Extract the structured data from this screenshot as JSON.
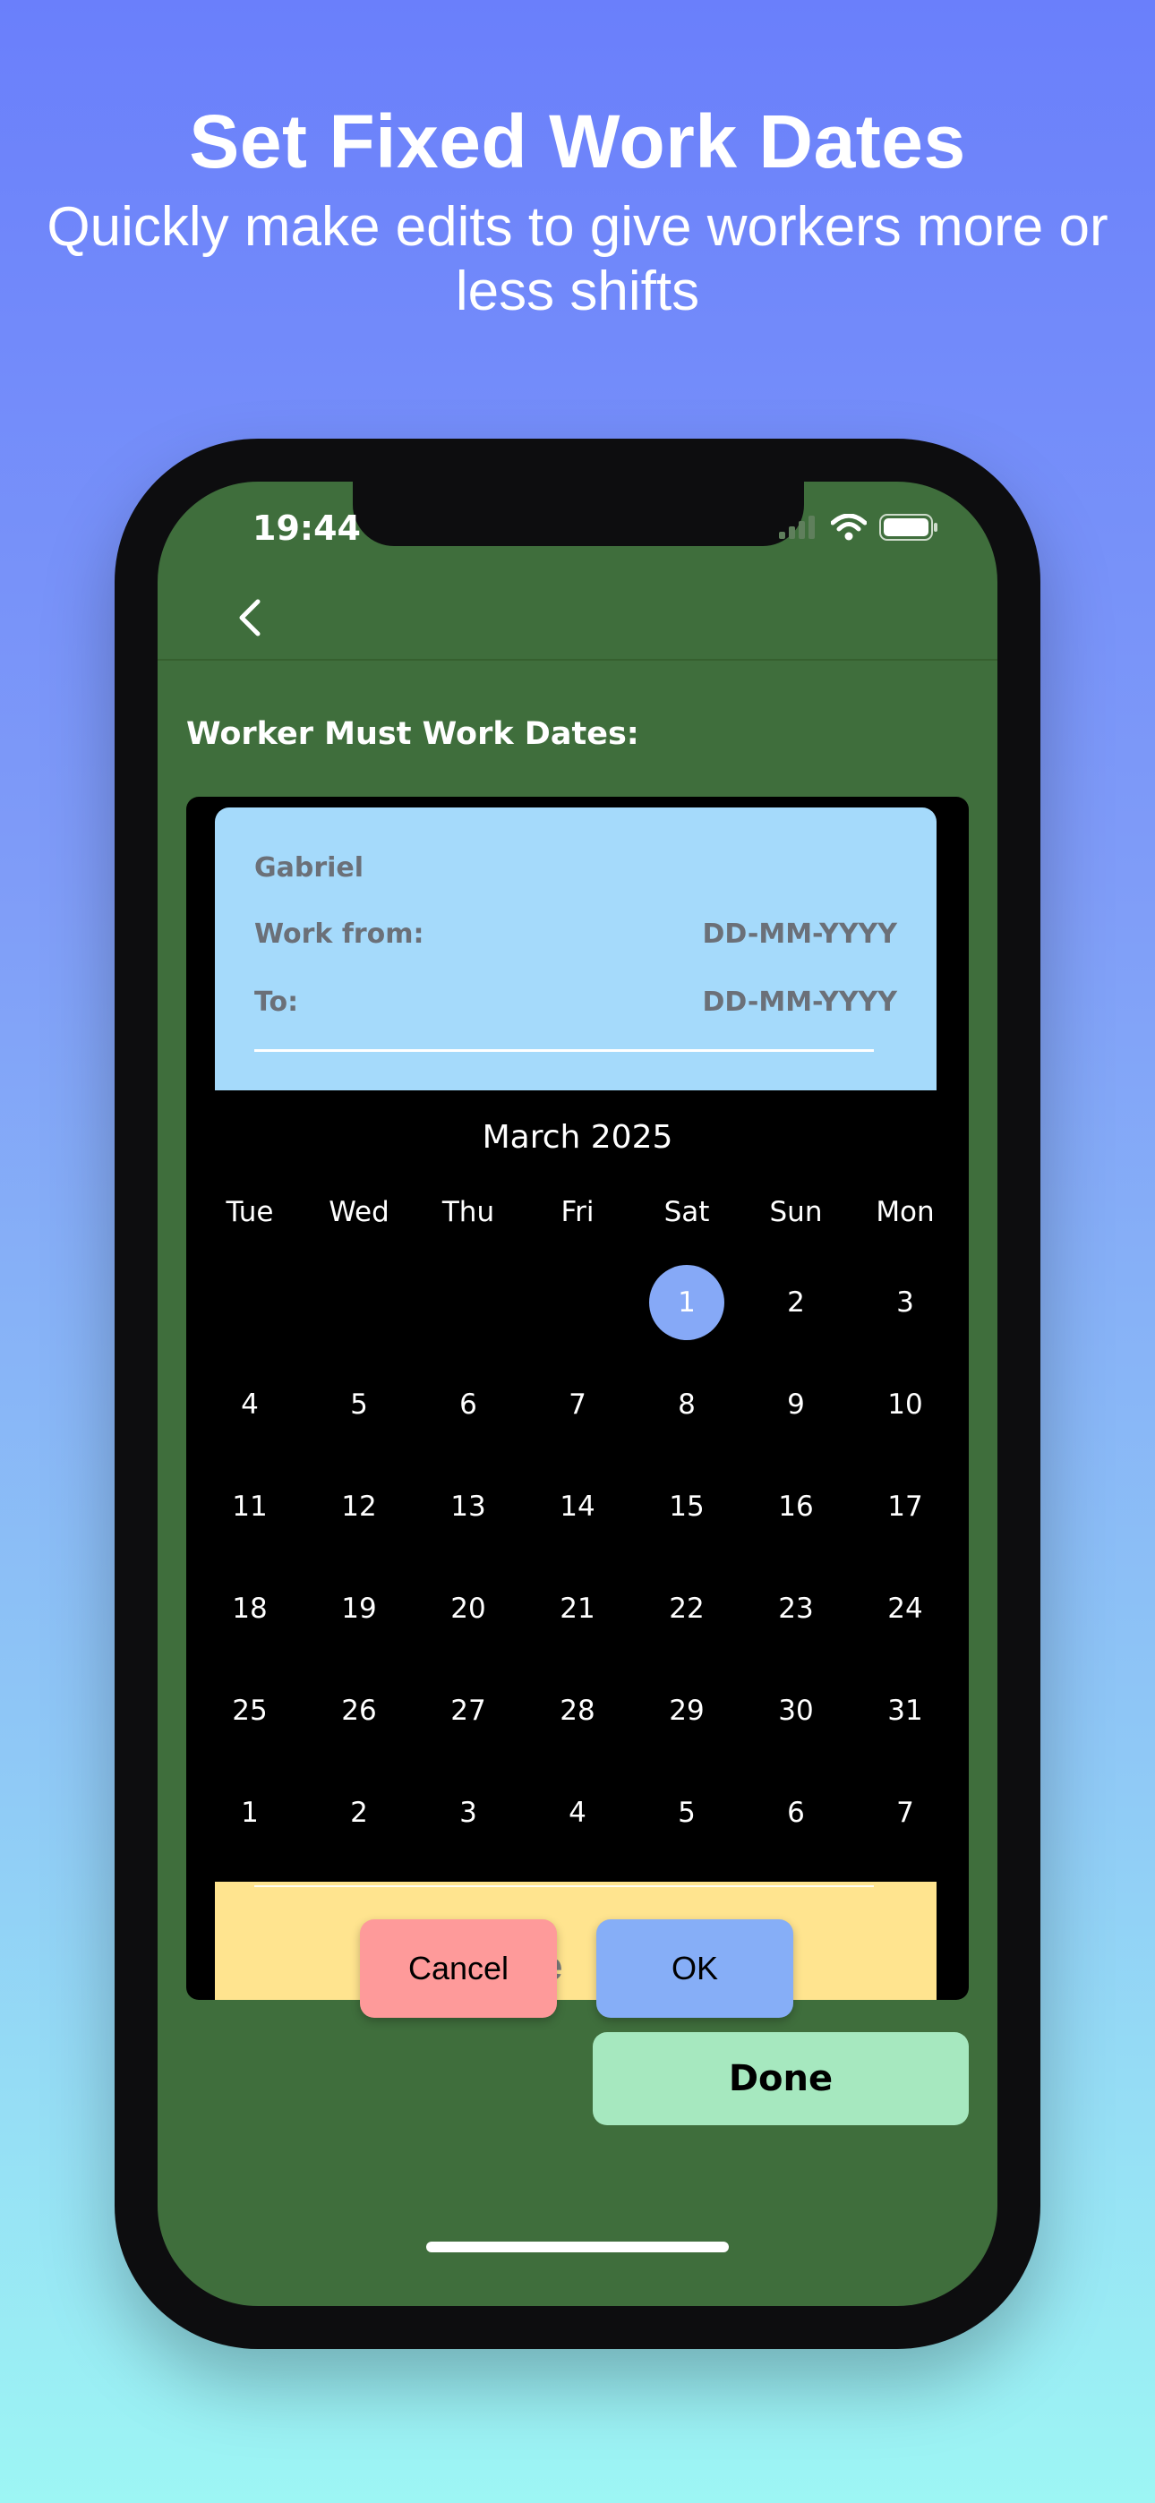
{
  "promo": {
    "title": "Set Fixed Work Dates",
    "subtitle": "Quickly make edits to give workers more or less shifts"
  },
  "status_bar": {
    "time": "19:44",
    "icons": [
      "signal-icon",
      "wifi-icon",
      "battery-icon"
    ]
  },
  "nav": {
    "back_icon": "chevron-left-icon"
  },
  "section_label": "Worker Must Work Dates:",
  "worker_card": {
    "name": "Gabriel",
    "work_from_label": "Work from:",
    "work_from_value": "DD-MM-YYYY",
    "to_label": "To:",
    "to_value": "DD-MM-YYYY"
  },
  "calendar": {
    "month_label": "March 2025",
    "weekdays": [
      "Tue",
      "Wed",
      "Thu",
      "Fri",
      "Sat",
      "Sun",
      "Mon"
    ],
    "weeks": [
      [
        "",
        "",
        "",
        "",
        "1",
        "2",
        "3"
      ],
      [
        "4",
        "5",
        "6",
        "7",
        "8",
        "9",
        "10"
      ],
      [
        "11",
        "12",
        "13",
        "14",
        "15",
        "16",
        "17"
      ],
      [
        "18",
        "19",
        "20",
        "21",
        "22",
        "23",
        "24"
      ],
      [
        "25",
        "26",
        "27",
        "28",
        "29",
        "30",
        "31"
      ],
      [
        "1",
        "2",
        "3",
        "4",
        "5",
        "6",
        "7"
      ]
    ],
    "selected_day": "1"
  },
  "underlay_text": "ore",
  "buttons": {
    "cancel": "Cancel",
    "ok": "OK",
    "done": "Done"
  },
  "colors": {
    "screen_bg": "#3f6e3c",
    "info_panel": "#a5dafb",
    "selected_day": "#86a9f7",
    "cancel": "#fe9a9a",
    "ok": "#86aef7",
    "done": "#a6e8bf",
    "underlay_panel": "#ffe48f"
  }
}
